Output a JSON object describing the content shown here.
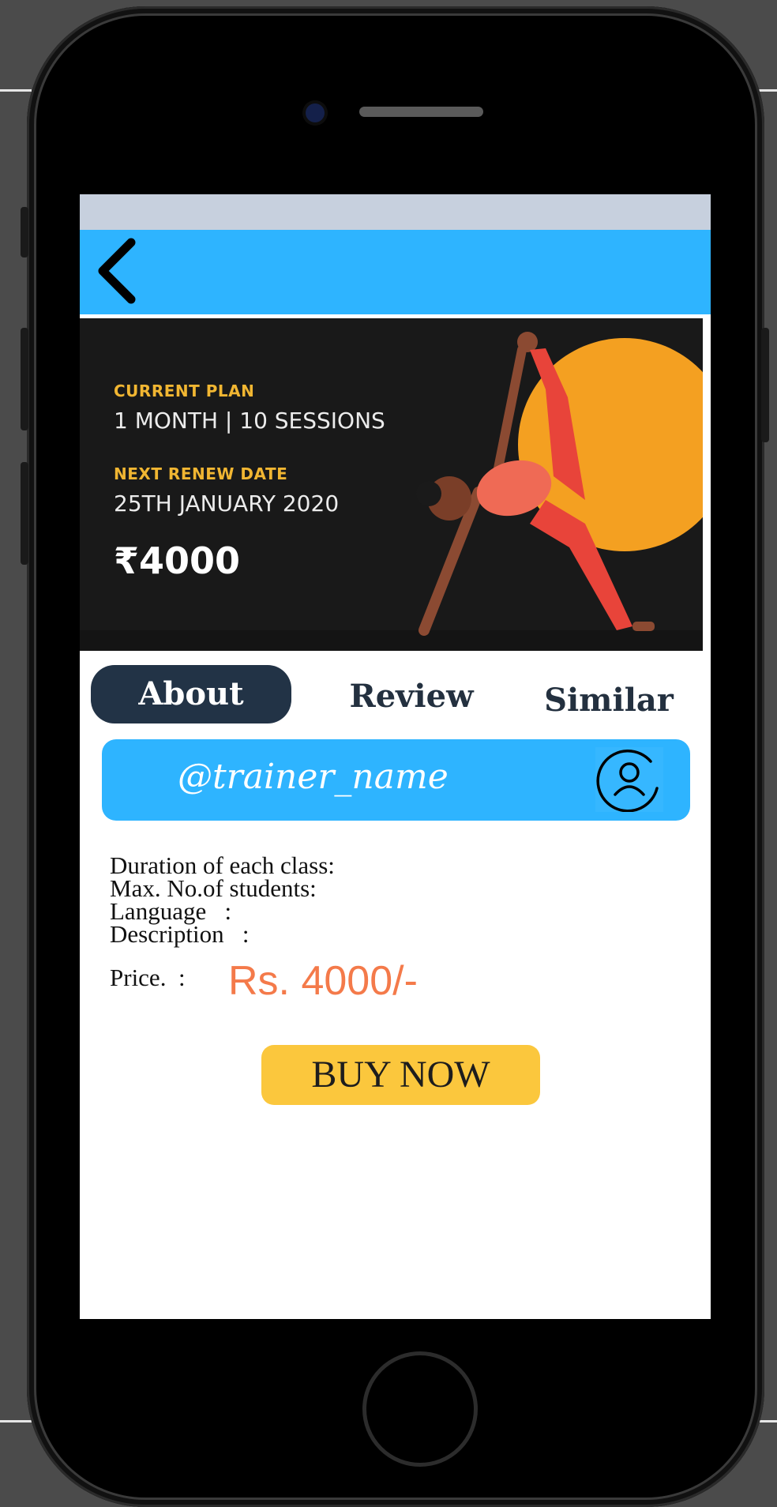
{
  "colors": {
    "app_bar": "#2eb4ff",
    "status_bar": "#c7d0de",
    "tab_active_bg": "#223346",
    "price": "#f47a4a",
    "buy_button": "#fbc73d",
    "banner_label": "#f1b632"
  },
  "header": {
    "back_icon": "chevron-left-icon"
  },
  "banner": {
    "current_plan_label": "CURRENT PLAN",
    "current_plan_value": "1 MONTH | 10 SESSIONS",
    "renew_label": "NEXT RENEW DATE",
    "renew_value": "25TH JANUARY 2020",
    "price": "₹4000"
  },
  "tabs": [
    {
      "label": "About",
      "active": true
    },
    {
      "label": "Review",
      "active": false
    },
    {
      "label": "Similar",
      "active": false
    }
  ],
  "trainer": {
    "name": "@trainer_name",
    "avatar_icon": "user-avatar-icon"
  },
  "details": {
    "duration": "Duration of each class:",
    "max_students": "Max. No.of students:",
    "language": "Language   :",
    "description": "Description   :"
  },
  "price": {
    "label": "Price.  :",
    "value": "Rs. 4000/-"
  },
  "buy_button": {
    "label": "BUY NOW"
  }
}
